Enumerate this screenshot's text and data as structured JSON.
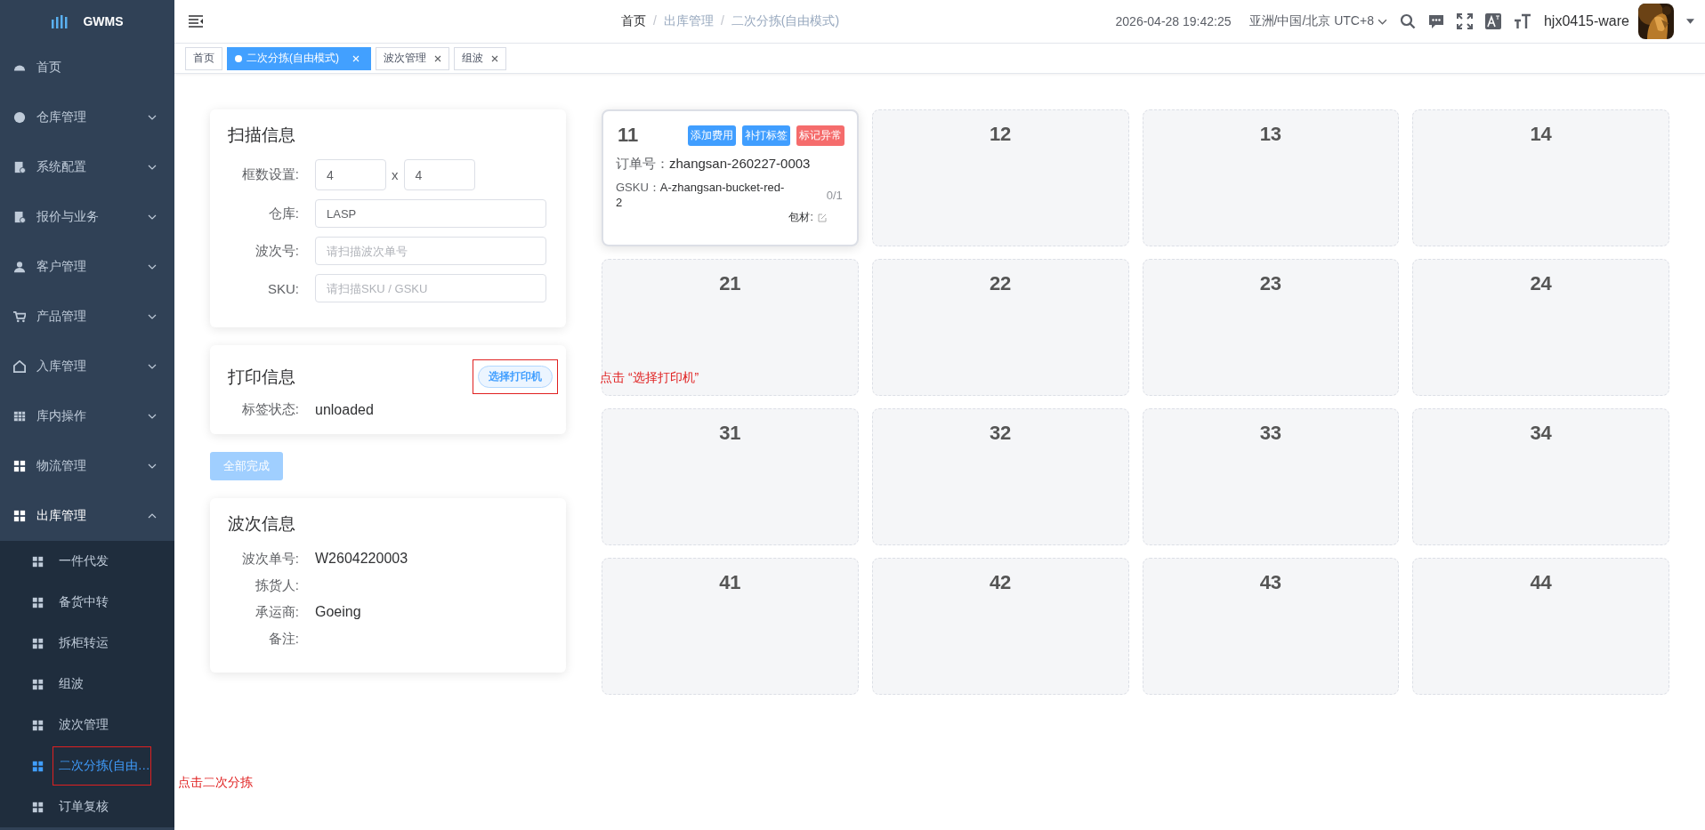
{
  "sidebar": {
    "logo": "GWMS",
    "items": [
      {
        "label": "首页",
        "expandable": false,
        "expanded": false
      },
      {
        "label": "仓库管理",
        "expandable": true,
        "expanded": false
      },
      {
        "label": "系统配置",
        "expandable": true,
        "expanded": false
      },
      {
        "label": "报价与业务",
        "expandable": true,
        "expanded": false
      },
      {
        "label": "客户管理",
        "expandable": true,
        "expanded": false
      },
      {
        "label": "产品管理",
        "expandable": true,
        "expanded": false
      },
      {
        "label": "入库管理",
        "expandable": true,
        "expanded": false
      },
      {
        "label": "库内操作",
        "expandable": true,
        "expanded": false
      },
      {
        "label": "物流管理",
        "expandable": true,
        "expanded": false
      },
      {
        "label": "出库管理",
        "expandable": true,
        "expanded": true,
        "children": [
          {
            "label": "一件代发",
            "selected": false
          },
          {
            "label": "备货中转",
            "selected": false
          },
          {
            "label": "拆柜转运",
            "selected": false
          },
          {
            "label": "组波",
            "selected": false
          },
          {
            "label": "波次管理",
            "selected": false
          },
          {
            "label": "二次分拣(自由…",
            "selected": true,
            "note": "点击二次分拣"
          },
          {
            "label": "订单复核",
            "selected": false
          }
        ]
      }
    ]
  },
  "header": {
    "breadcrumb": [
      {
        "label": "首页"
      },
      {
        "separator": "/",
        "label": "出库管理"
      },
      {
        "separator": "/",
        "label": "二次分拣(自由模式)"
      }
    ],
    "datetime": "2026-04-28 19:42:25",
    "timezone": "亚洲/中国/北京 UTC+8",
    "username": "hjx0415-ware"
  },
  "tabs": [
    {
      "label": "首页",
      "selected": false,
      "closable": false
    },
    {
      "label": "二次分拣(自由模式)",
      "selected": true,
      "closable": true
    },
    {
      "label": "波次管理",
      "selected": false,
      "closable": true
    },
    {
      "label": "组波",
      "selected": false,
      "closable": true
    }
  ],
  "scan_panel": {
    "title": "扫描信息",
    "grid_label": "框数设置:",
    "grid_rows": "4",
    "grid_separator": "x",
    "grid_cols": "4",
    "fields": [
      {
        "label": "仓库:",
        "value": "LASP"
      },
      {
        "label": "波次号:",
        "placeholder": "请扫描波次单号"
      },
      {
        "label": "SKU:",
        "placeholder": "请扫描SKU / GSKU"
      }
    ]
  },
  "print_panel": {
    "title": "打印信息",
    "button": "选择打印机",
    "highlighted": true,
    "note": "点击 “选择打印机”",
    "status_label": "标签状态:",
    "status": "unloaded"
  },
  "complete_button": {
    "label": "全部完成",
    "disabled": true
  },
  "wave_panel": {
    "title": "波次信息",
    "rows": [
      {
        "label": "波次单号:",
        "value": "W2604220003"
      },
      {
        "label": "拣货人:"
      },
      {
        "label": "承运商:",
        "value": "Goeing"
      },
      {
        "label": "备注:"
      }
    ]
  },
  "slots": [
    {
      "number": "11",
      "active": true,
      "actions": [
        {
          "label": "添加费用",
          "color": "#409eff"
        },
        {
          "label": "补打标签",
          "color": "#409eff"
        },
        {
          "label": "标记异常",
          "color": "#f56c6c"
        }
      ],
      "order_label": "订单号：",
      "order": "zhangsan-260227-0003",
      "gsku_label": "GSKU：",
      "gsku": "A-zhangsan-bucket-red-2",
      "count": "0/1",
      "material_label": "包材:"
    },
    {
      "number": "12",
      "active": false
    },
    {
      "number": "13",
      "active": false
    },
    {
      "number": "14",
      "active": false
    },
    {
      "number": "21",
      "active": false
    },
    {
      "number": "22",
      "active": false
    },
    {
      "number": "23",
      "active": false
    },
    {
      "number": "24",
      "active": false
    },
    {
      "number": "31",
      "active": false
    },
    {
      "number": "32",
      "active": false
    },
    {
      "number": "33",
      "active": false
    },
    {
      "number": "34",
      "active": false
    },
    {
      "number": "41",
      "active": false
    },
    {
      "number": "42",
      "active": false
    },
    {
      "number": "43",
      "active": false
    },
    {
      "number": "44",
      "active": false
    }
  ]
}
